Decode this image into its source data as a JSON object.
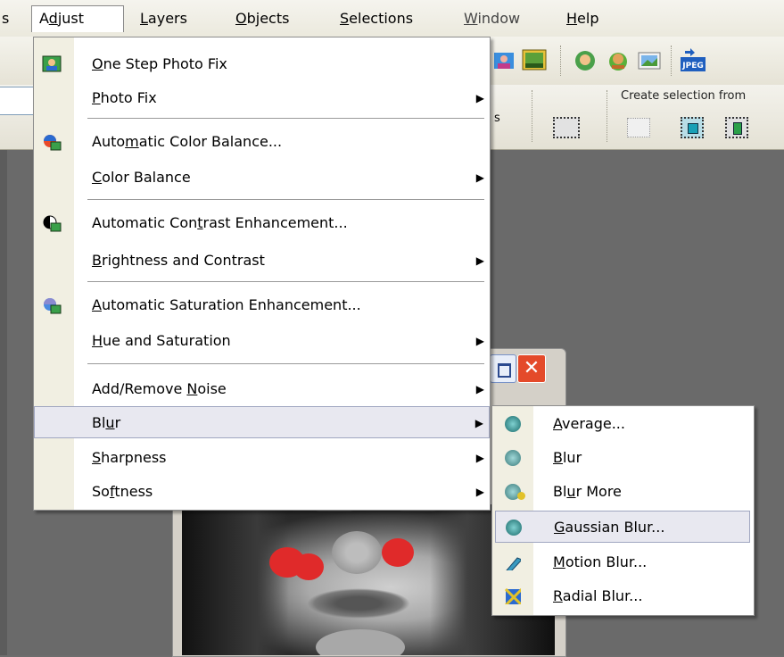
{
  "menubar": {
    "items": [
      {
        "label": "s",
        "key": ""
      },
      {
        "label": "Adjust",
        "pre": "A",
        "key": "d",
        "post": "just"
      },
      {
        "label": "Layers",
        "pre": "",
        "key": "L",
        "post": "ayers"
      },
      {
        "label": "Objects",
        "pre": "",
        "key": "O",
        "post": "bjects"
      },
      {
        "label": "Selections",
        "pre": "",
        "key": "S",
        "post": "elections"
      },
      {
        "label": "Window",
        "pre": "",
        "key": "W",
        "post": "indow"
      },
      {
        "label": "Help",
        "pre": "",
        "key": "H",
        "post": "elp"
      }
    ]
  },
  "toolbar": {
    "create_selection_label": "Create selection from",
    "fragment_s": "s",
    "jpeg_icon_text": "JPEG"
  },
  "adjust_menu": {
    "items": [
      {
        "pre": "",
        "key": "O",
        "post": "ne Step Photo Fix",
        "submenu": false
      },
      {
        "pre": "",
        "key": "P",
        "post": "hoto Fix",
        "submenu": true
      },
      {
        "pre": "Auto",
        "key": "m",
        "post": "atic Color Balance...",
        "submenu": false
      },
      {
        "pre": "",
        "key": "C",
        "post": "olor Balance",
        "submenu": true
      },
      {
        "pre": "Automatic Con",
        "key": "t",
        "post": "rast Enhancement...",
        "submenu": false
      },
      {
        "pre": "",
        "key": "B",
        "post": "rightness and Contrast",
        "submenu": true
      },
      {
        "pre": "",
        "key": "A",
        "post": "utomatic Saturation Enhancement...",
        "submenu": false
      },
      {
        "pre": "",
        "key": "H",
        "post": "ue and Saturation",
        "submenu": true
      },
      {
        "pre": "Add/Remove ",
        "key": "N",
        "post": "oise",
        "submenu": true
      },
      {
        "pre": "Bl",
        "key": "u",
        "post": "r",
        "submenu": true
      },
      {
        "pre": "",
        "key": "S",
        "post": "harpness",
        "submenu": true
      },
      {
        "pre": "So",
        "key": "f",
        "post": "tness",
        "submenu": true
      }
    ]
  },
  "blur_menu": {
    "items": [
      {
        "pre": "",
        "key": "A",
        "post": "verage..."
      },
      {
        "pre": "",
        "key": "B",
        "post": "lur"
      },
      {
        "pre": "Bl",
        "key": "u",
        "post": "r More"
      },
      {
        "pre": "",
        "key": "G",
        "post": "aussian Blur..."
      },
      {
        "pre": "",
        "key": "M",
        "post": "otion Blur..."
      },
      {
        "pre": "",
        "key": "R",
        "post": "adial Blur..."
      }
    ]
  },
  "submenu_arrow": "▶",
  "close_glyph": "✕",
  "colors": {
    "menu_highlight": "#e8e8f0",
    "close_button": "#e44a2a",
    "blush": "#e02a2a",
    "workspace": "#6a6a6a"
  }
}
